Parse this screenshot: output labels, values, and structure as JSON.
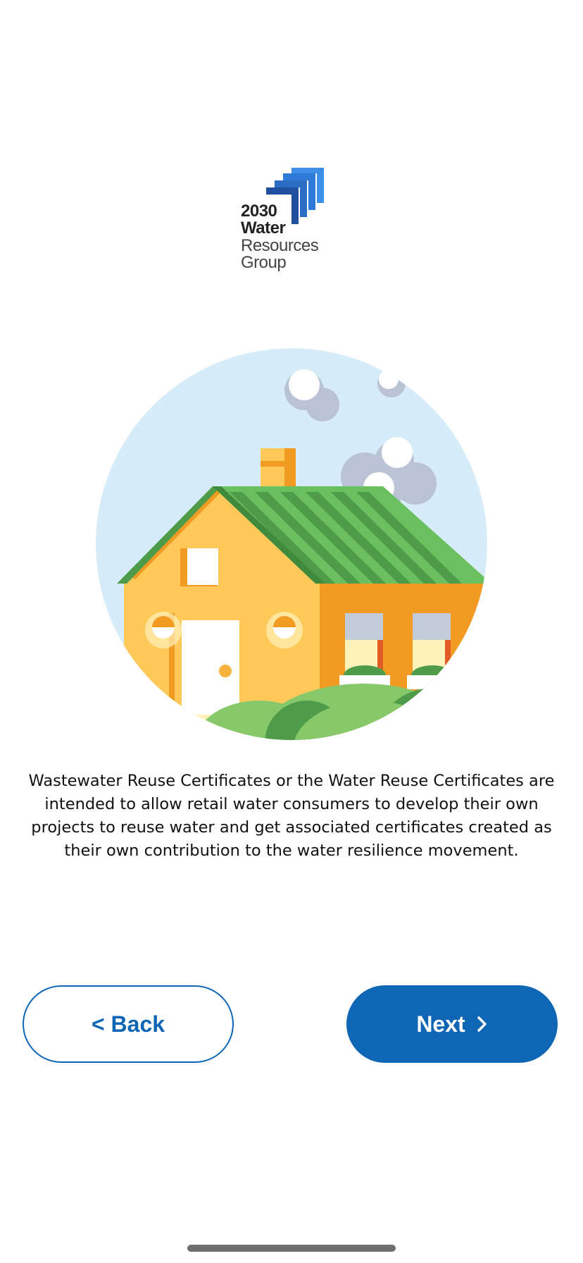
{
  "logo": {
    "line1": "2030",
    "line2": "Water",
    "line3": "Resources",
    "line4": "Group",
    "colors": {
      "mark_dark": "#1f4f9e",
      "mark_light": "#2d7ad8"
    }
  },
  "illustration": {
    "icon": "house-illustration",
    "colors": {
      "sky": "#d6ecf8",
      "roof": "#6abf5e",
      "wall_front": "#ffc95a",
      "wall_side": "#f29b22",
      "smoke": "#b9c3d3",
      "bush": "#86c86a"
    }
  },
  "description": "Wastewater Reuse Certificates or the Water Reuse Certificates are intended to allow retail water consumers to develop their own projects to reuse water and get associated certificates created as their own contribution to the water resilience movement.",
  "buttons": {
    "back_label": "< Back",
    "next_label": "Next",
    "next_icon": "chevron-right-icon",
    "accent": "#0f66b5"
  }
}
